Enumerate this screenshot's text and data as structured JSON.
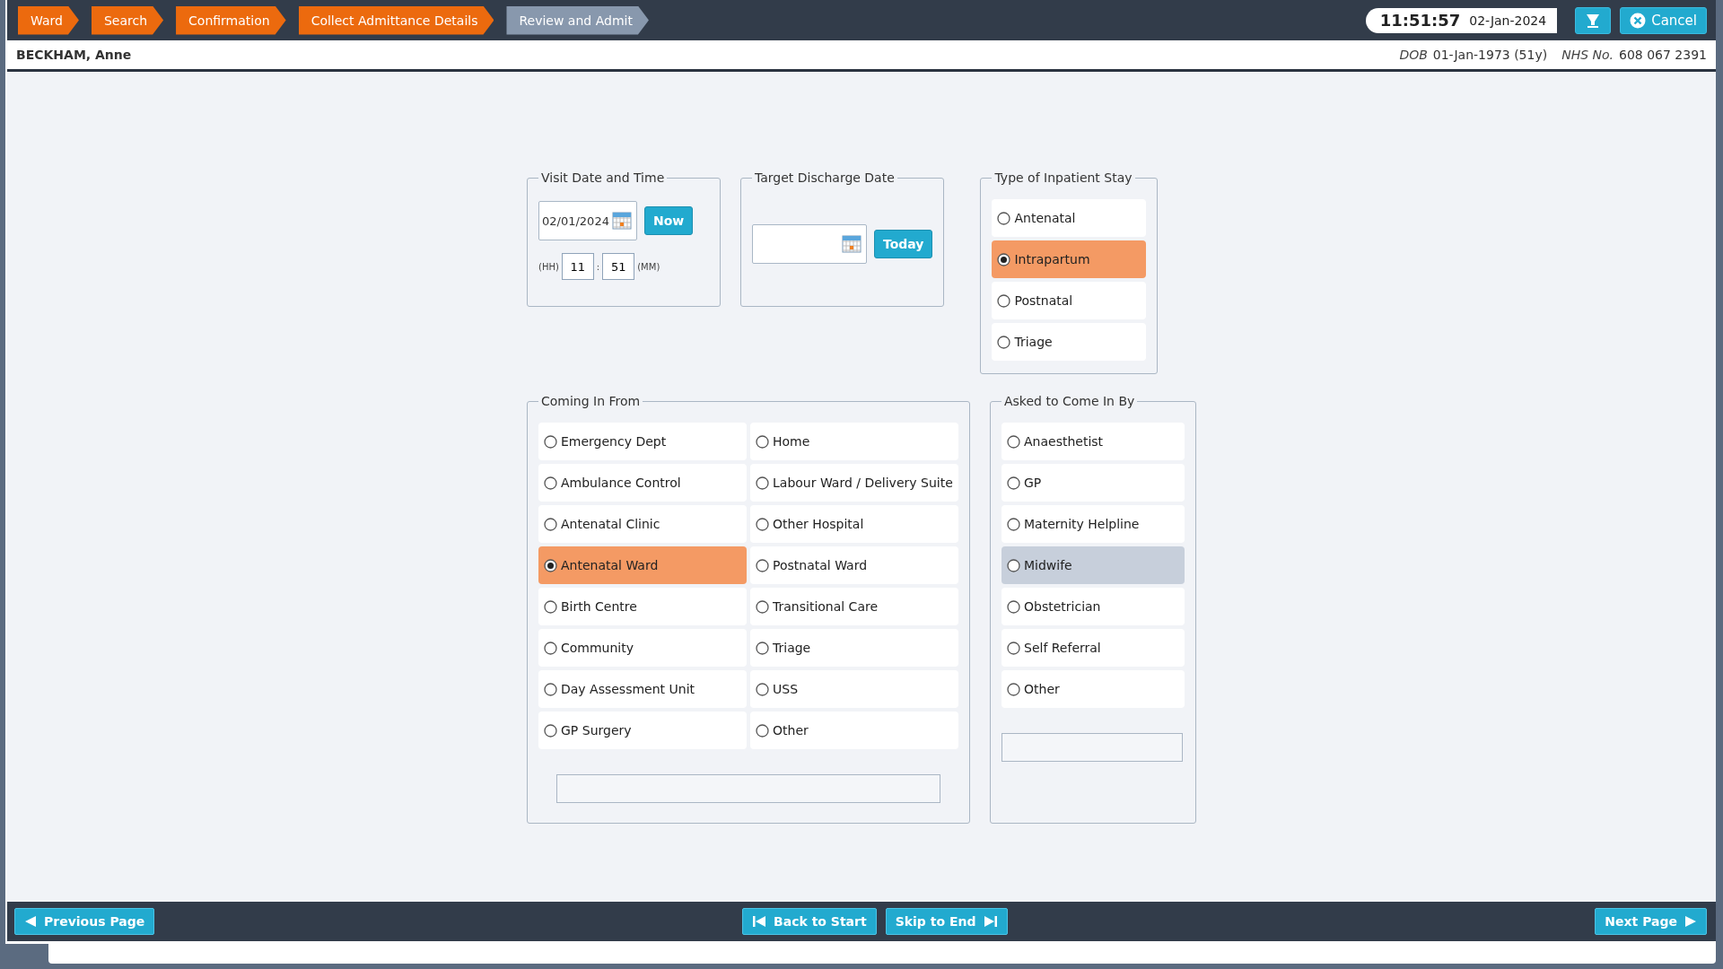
{
  "breadcrumbs": [
    {
      "label": "Ward",
      "current": false
    },
    {
      "label": "Search",
      "current": false
    },
    {
      "label": "Confirmation",
      "current": false
    },
    {
      "label": "Collect Admittance Details",
      "current": false
    },
    {
      "label": "Review and Admit",
      "current": true
    }
  ],
  "clock": {
    "time": "11:51:57",
    "date": "02-Jan-2024"
  },
  "cancel_button": "Cancel",
  "patient": {
    "name": "BECKHAM, Anne",
    "dob_label": "DOB",
    "dob": "01-Jan-1973 (51y)",
    "nhs_label": "NHS No.",
    "nhs": "608 067 2391"
  },
  "visit": {
    "legend": "Visit Date and Time",
    "date": "02/01/2024",
    "now_button": "Now",
    "hh_label": "(HH)",
    "hour": "11",
    "separator": ":",
    "minute": "51",
    "mm_label": "(MM)"
  },
  "discharge": {
    "legend": "Target Discharge Date",
    "today_button": "Today"
  },
  "inpatient_type": {
    "legend": "Type of Inpatient Stay",
    "options": [
      {
        "label": "Antenatal",
        "selected": false
      },
      {
        "label": "Intrapartum",
        "selected": true
      },
      {
        "label": "Postnatal",
        "selected": false
      },
      {
        "label": "Triage",
        "selected": false
      }
    ]
  },
  "coming_in_from": {
    "legend": "Coming In From",
    "options": [
      {
        "label": "Emergency Dept",
        "selected": false
      },
      {
        "label": "Home",
        "selected": false
      },
      {
        "label": "Ambulance Control",
        "selected": false
      },
      {
        "label": "Labour Ward / Delivery Suite",
        "selected": false
      },
      {
        "label": "Antenatal Clinic",
        "selected": false
      },
      {
        "label": "Other Hospital",
        "selected": false
      },
      {
        "label": "Antenatal Ward",
        "selected": true
      },
      {
        "label": "Postnatal Ward",
        "selected": false
      },
      {
        "label": "Birth Centre",
        "selected": false
      },
      {
        "label": "Transitional Care",
        "selected": false
      },
      {
        "label": "Community",
        "selected": false
      },
      {
        "label": "Triage",
        "selected": false
      },
      {
        "label": "Day Assessment Unit",
        "selected": false
      },
      {
        "label": "USS",
        "selected": false
      },
      {
        "label": "GP Surgery",
        "selected": false
      },
      {
        "label": "Other",
        "selected": false
      }
    ]
  },
  "asked_by": {
    "legend": "Asked to Come In By",
    "options": [
      {
        "label": "Anaesthetist",
        "selected": false,
        "highlighted": false
      },
      {
        "label": "GP",
        "selected": false,
        "highlighted": false
      },
      {
        "label": "Maternity Helpline",
        "selected": false,
        "highlighted": false
      },
      {
        "label": "Midwife",
        "selected": false,
        "highlighted": true
      },
      {
        "label": "Obstetrician",
        "selected": false,
        "highlighted": false
      },
      {
        "label": "Self Referral",
        "selected": false,
        "highlighted": false
      },
      {
        "label": "Other",
        "selected": false,
        "highlighted": false
      }
    ]
  },
  "footer": {
    "previous": "Previous Page",
    "back": "Back to Start",
    "skip": "Skip to End",
    "next": "Next Page"
  }
}
